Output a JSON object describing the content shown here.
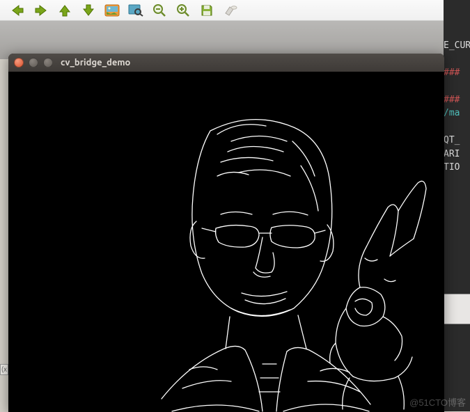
{
  "toolbar": {
    "icons": [
      {
        "name": "arrow-left-icon"
      },
      {
        "name": "arrow-right-icon"
      },
      {
        "name": "arrow-up-icon"
      },
      {
        "name": "arrow-down-icon"
      },
      {
        "name": "picture-icon"
      },
      {
        "name": "search-image-icon"
      },
      {
        "name": "zoom-out-icon"
      },
      {
        "name": "zoom-in-icon"
      },
      {
        "name": "save-icon"
      },
      {
        "name": "clear-icon"
      }
    ]
  },
  "window": {
    "title": "cv_bridge_demo"
  },
  "terminal": {
    "line1": "E_CUR",
    "line2": "###",
    "line3": "###",
    "line4": "/ma",
    "line5": "QT_",
    "line6": "ARI",
    "line7": "TIO"
  },
  "watermark": "@51CTO博客",
  "tiny_tab": "(x"
}
